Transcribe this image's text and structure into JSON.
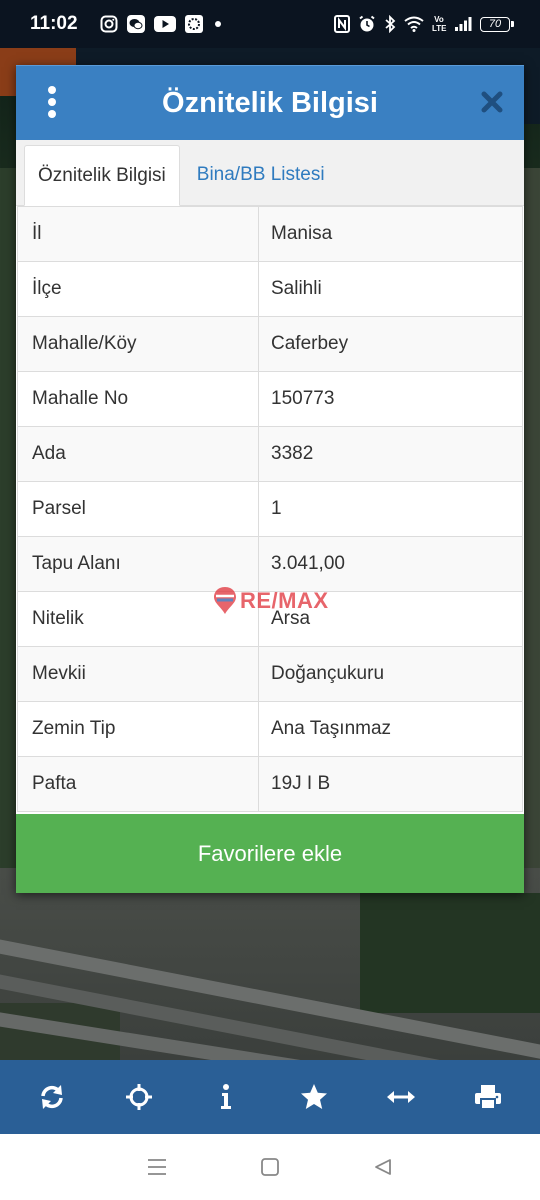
{
  "status_bar": {
    "time": "11:02",
    "battery": "70",
    "network": "Vo LTE",
    "left_icons": [
      "instagram-icon",
      "wechat-icon",
      "youtube-icon",
      "app-icon",
      "dot-icon"
    ],
    "right_icons": [
      "nfc-icon",
      "alarm-icon",
      "bluetooth-icon",
      "wifi-icon",
      "signal-icon",
      "battery-icon"
    ]
  },
  "dialog": {
    "title": "Öznitelik Bilgisi",
    "tabs": [
      {
        "label": "Öznitelik Bilgisi",
        "active": true
      },
      {
        "label": "Bina/BB Listesi",
        "active": false
      }
    ],
    "rows": [
      {
        "key": "İl",
        "value": "Manisa"
      },
      {
        "key": "İlçe",
        "value": "Salihli"
      },
      {
        "key": "Mahalle/Köy",
        "value": "Caferbey"
      },
      {
        "key": "Mahalle No",
        "value": "150773"
      },
      {
        "key": "Ada",
        "value": "3382"
      },
      {
        "key": "Parsel",
        "value": "1"
      },
      {
        "key": "Tapu Alanı",
        "value": "3.041,00"
      },
      {
        "key": "Nitelik",
        "value": "Arsa"
      },
      {
        "key": "Mevkii",
        "value": "Doğançukuru"
      },
      {
        "key": "Zemin Tip",
        "value": "Ana Taşınmaz"
      },
      {
        "key": "Pafta",
        "value": "19J I B"
      }
    ],
    "favorite_button": "Favorilere ekle"
  },
  "watermark": {
    "text": "RE/MAX",
    "small": "REMAX"
  },
  "toolbar": [
    "refresh-icon",
    "locate-icon",
    "info-icon",
    "star-icon",
    "measure-icon",
    "print-icon"
  ],
  "navbar": [
    "menu-icon",
    "home-icon",
    "back-icon"
  ],
  "colors": {
    "header": "#3a80c2",
    "tab_link": "#2f7bbf",
    "favorite": "#55b152",
    "toolbar": "#2a5f96"
  }
}
